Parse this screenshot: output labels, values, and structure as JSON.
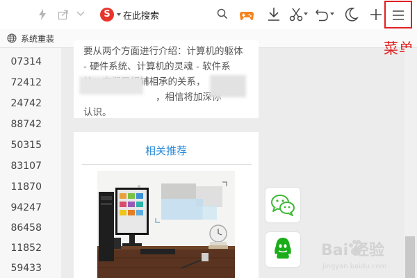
{
  "toolbar": {
    "search_placeholder": "在此搜索",
    "menu_label": "菜单"
  },
  "bookmarks": [
    {
      "label": "系统重装",
      "icon": "globe-icon"
    }
  ],
  "sidebar_numbers": [
    "07314",
    "72412",
    "24742",
    "88742",
    "50315",
    "83107",
    "11870",
    "94247",
    "86458",
    "11852",
    "59433"
  ],
  "article": {
    "lines": [
      "要从两个方面进行介绍：计算机的躯体",
      "- 硬件系统、计算机的灵魂 - 软件系",
      "统：它们是相辅相承的关系，",
      "，相信将加深你",
      "认识。"
    ]
  },
  "recommend": {
    "title": "相关推荐"
  },
  "share": {
    "wechat_icon": "wechat-icon",
    "qq_icon": "qq-icon"
  },
  "watermark": {
    "text": "Bai  经验",
    "url": "jingyan.baidu.com"
  },
  "colors": {
    "annotation": "#e02020",
    "link": "#2a8ad8",
    "game_icon": "#f5841f",
    "wechat": "#3fb838",
    "qq": "#1aad19"
  }
}
